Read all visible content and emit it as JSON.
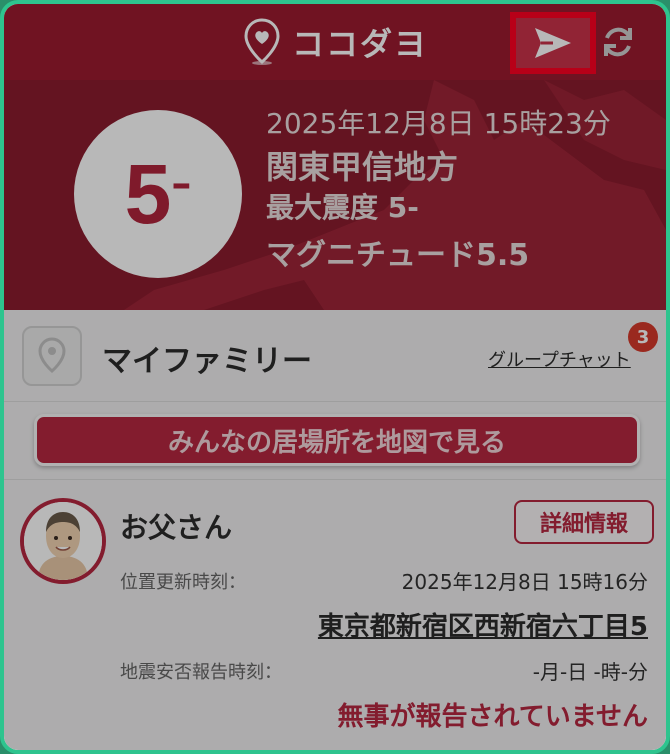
{
  "header": {
    "title": "ココダヨ"
  },
  "quake": {
    "intensity": "5",
    "intensity_suffix": "–",
    "datetime": "2025年12月8日 15時23分",
    "region": "関東甲信地方",
    "max_intensity": "最大震度 5-",
    "magnitude": "マグニチュード5.5"
  },
  "family": {
    "title": "マイファミリー",
    "chat_link": "グループチャット",
    "chat_badge": "3",
    "map_button": "みんなの居場所を地図で見る"
  },
  "member": {
    "name": "お父さん",
    "detail_button": "詳細情報",
    "location_update_label": "位置更新時刻：",
    "location_update_value": "2025年12月8日 15時16分",
    "address": "東京都新宿区西新宿六丁目5",
    "safety_label": "地震安否報告時刻：",
    "safety_value": "-月-日 -時-分",
    "unsafe_message": "無事が報告されていません"
  },
  "colors": {
    "brand": "#9c1b30",
    "accent": "#b62740",
    "highlight_border": "#ff0022",
    "badge": "#d63a2b"
  },
  "icons": [
    "location-pin-icon",
    "send-icon",
    "refresh-icon",
    "avatar-icon"
  ]
}
